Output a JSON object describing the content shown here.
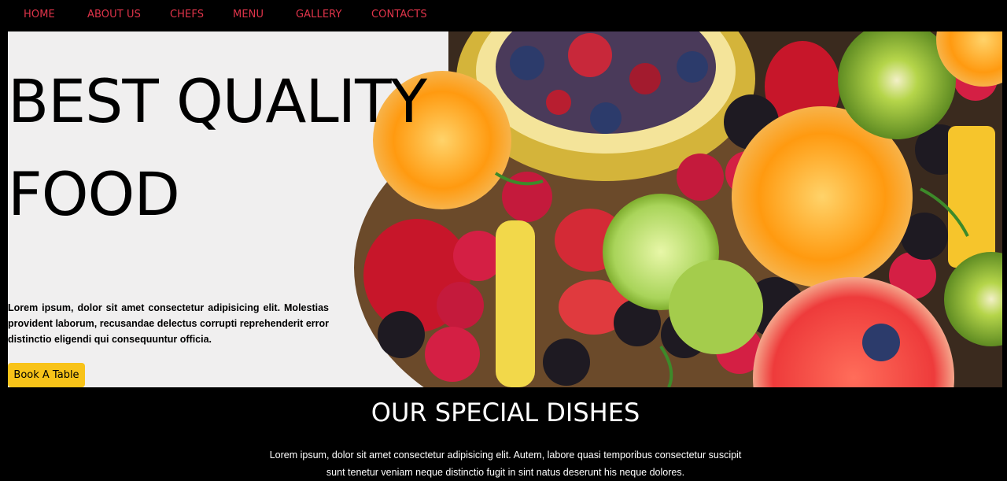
{
  "nav": {
    "items": [
      {
        "label": "HOME"
      },
      {
        "label": "ABOUT US"
      },
      {
        "label": "CHEFS"
      },
      {
        "label": "MENU"
      },
      {
        "label": "GALLERY"
      },
      {
        "label": "CONTACTS"
      }
    ]
  },
  "hero": {
    "title_line1": "BEST QUALITY",
    "title_line2": "FOOD",
    "text": "Lorem ipsum, dolor sit amet consectetur adipisicing elit. Molestias provident laborum, recusandae delectus corrupti reprehenderit error distinctio eligendi qui consequuntur officia.",
    "button_label": "Book A Table",
    "image": "fresh-fruit-platter"
  },
  "special": {
    "title": "OUR SPECIAL DISHES",
    "text": "Lorem ipsum, dolor sit amet consectetur adipisicing elit. Autem, labore quasi temporibus consectetur suscipit sunt tenetur veniam neque distinctio fugit in sint natus deserunt his neque dolores."
  },
  "colors": {
    "nav_link": "#e0344a",
    "button": "#f8c319",
    "background": "#000000"
  }
}
